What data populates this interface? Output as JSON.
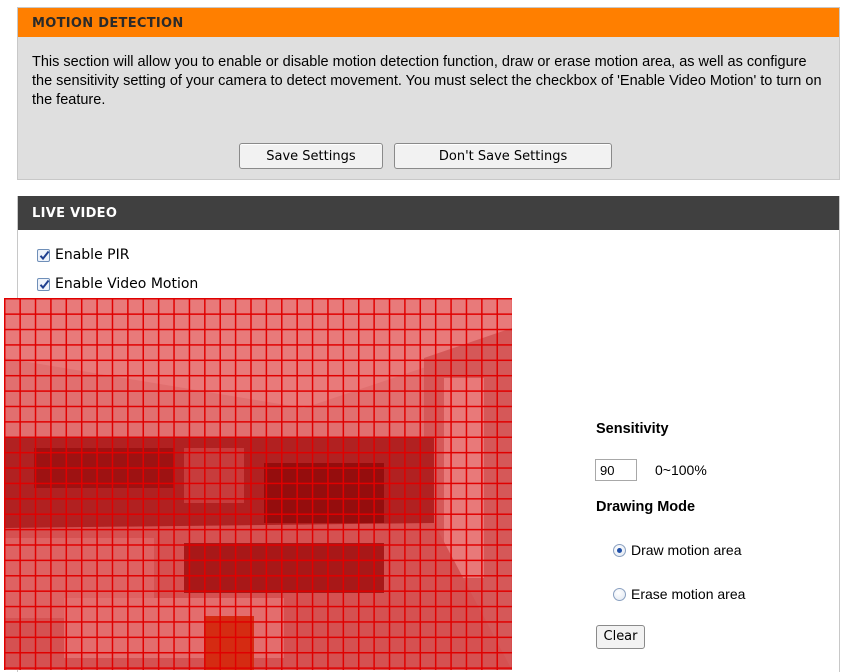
{
  "motion_detection": {
    "title": "MOTION DETECTION",
    "description": "This section will allow you to enable or disable motion detection function, draw or erase motion area, as well as configure the sensitivity setting of your camera to detect movement. You must select the checkbox of 'Enable Video Motion' to turn on the feature.",
    "save_label": "Save Settings",
    "dont_save_label": "Don't Save Settings",
    "accent_color": "#ff7f00"
  },
  "live_video": {
    "title": "LIVE VIDEO",
    "enable_pir_label": "Enable PIR",
    "enable_pir_checked": true,
    "enable_video_motion_label": "Enable Video Motion",
    "enable_video_motion_checked": true
  },
  "controls": {
    "sensitivity_label": "Sensitivity",
    "sensitivity_value": "90",
    "sensitivity_range": "0~100%",
    "drawing_mode_label": "Drawing Mode",
    "draw_label": "Draw motion area",
    "erase_label": "Erase motion area",
    "selected_mode": "draw",
    "clear_label": "Clear"
  }
}
